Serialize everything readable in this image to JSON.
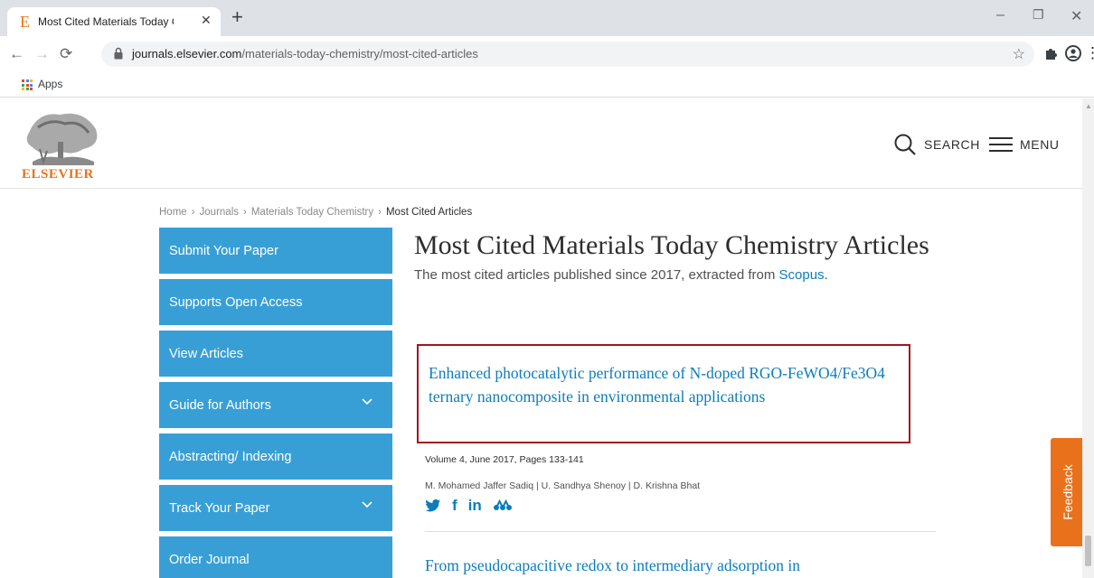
{
  "browser": {
    "tab_title": "Most Cited Materials Today Chem",
    "tab_favicon": "E",
    "tab_close": "✕",
    "new_tab": "+",
    "url_domain": "journals.elsevier.com",
    "url_path": "/materials-today-chemistry/most-cited-articles",
    "bookmarks_apps": "Apps",
    "icons": {
      "back": "←",
      "forward": "→",
      "reload": "⟳",
      "star": "☆",
      "extensions": "puzzle-icon",
      "profile": "account-icon",
      "more": "⋮",
      "minimize": "–",
      "maximize": "❐",
      "close": "✕"
    }
  },
  "header": {
    "logo_text": "ELSEVIER",
    "search_label": "SEARCH",
    "menu_label": "MENU"
  },
  "breadcrumb": {
    "items": [
      "Home",
      "Journals",
      "Materials Today Chemistry"
    ],
    "current": "Most Cited Articles",
    "separator": "›"
  },
  "sidenav": {
    "items": [
      {
        "label": "Submit Your Paper"
      },
      {
        "label": "Supports Open Access"
      },
      {
        "label": "View Articles"
      },
      {
        "label": "Guide for Authors"
      },
      {
        "label": "Abstracting/ Indexing"
      },
      {
        "label": "Track Your Paper"
      },
      {
        "label": "Order Journal"
      }
    ]
  },
  "main": {
    "title": "Most Cited Materials Today Chemistry Articles",
    "intro": "The most cited articles published since 2017, extracted from",
    "intro_link": "Scopus",
    "intro_end": ".",
    "articles": [
      {
        "title": "Enhanced photocatalytic performance of N-doped RGO-FeWO4/Fe3O4 ternary nanocomposite in environmental applications",
        "meta": "Volume 4, June 2017, Pages 133-141",
        "authors": "M. Mohamed Jaffer Sadiq | U. Sandhya Shenoy | D. Krishna Bhat"
      },
      {
        "title": "From pseudocapacitive redox to intermediary adsorption in"
      }
    ],
    "share": {
      "facebook": "f",
      "linkedin": "in"
    }
  },
  "feedback": {
    "label": "Feedback"
  },
  "colors": {
    "elsevier_orange": "#e9711c",
    "nav_blue": "#389fd6",
    "link_blue": "#0c7dbb",
    "highlight_red": "#a2141e"
  }
}
